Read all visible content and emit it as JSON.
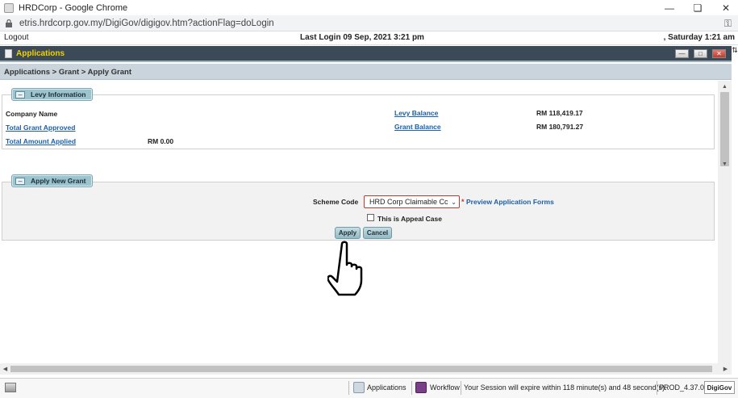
{
  "browser": {
    "window_title": "HRDCorp - Google Chrome",
    "url": "etris.hrdcorp.gov.my/DigiGov/digigov.htm?actionFlag=doLogin"
  },
  "header": {
    "logout_label": "Logout",
    "last_login": "Last Login 09 Sep, 2021 3:21 pm",
    "date_time": ", Saturday 1:21 am"
  },
  "appbar": {
    "title": "Applications"
  },
  "breadcrumb": "Applications > Grant > Apply Grant",
  "levy_section": {
    "title": "Levy Information",
    "company_name_label": "Company Name",
    "total_grant_approved_label": "Total Grant Approved",
    "total_amount_applied_label": "Total Amount Applied",
    "total_amount_applied_value": "RM 0.00",
    "levy_balance_label": "Levy Balance",
    "levy_balance_value": "RM 118,419.17",
    "grant_balance_label": "Grant Balance",
    "grant_balance_value": "RM 180,791.27"
  },
  "apply_section": {
    "title": "Apply New Grant",
    "scheme_code_label": "Scheme Code",
    "scheme_code_value": "HRD Corp Claimable Cc",
    "required_mark": "*",
    "preview_link": "Preview Application Forms",
    "appeal_label": "This is Appeal Case",
    "apply_button": "Apply",
    "cancel_button": "Cancel"
  },
  "statusbar": {
    "applications_label": "Applications",
    "workflow_label": "Workflow",
    "session_text": "Your Session will expire within 118 minute(s) and 48 second(s).",
    "version": "PROD_4.37.0",
    "brand": "DigiGov"
  },
  "icons": {
    "favicon": "page-icon",
    "cursor": "hand-pointer-icon"
  },
  "colors": {
    "appbar_bg": "#3b4a56",
    "appbar_title": "#f2d200",
    "link": "#1a5fa8",
    "tab_bg": "#9cc4cf",
    "required": "#c0392b"
  }
}
